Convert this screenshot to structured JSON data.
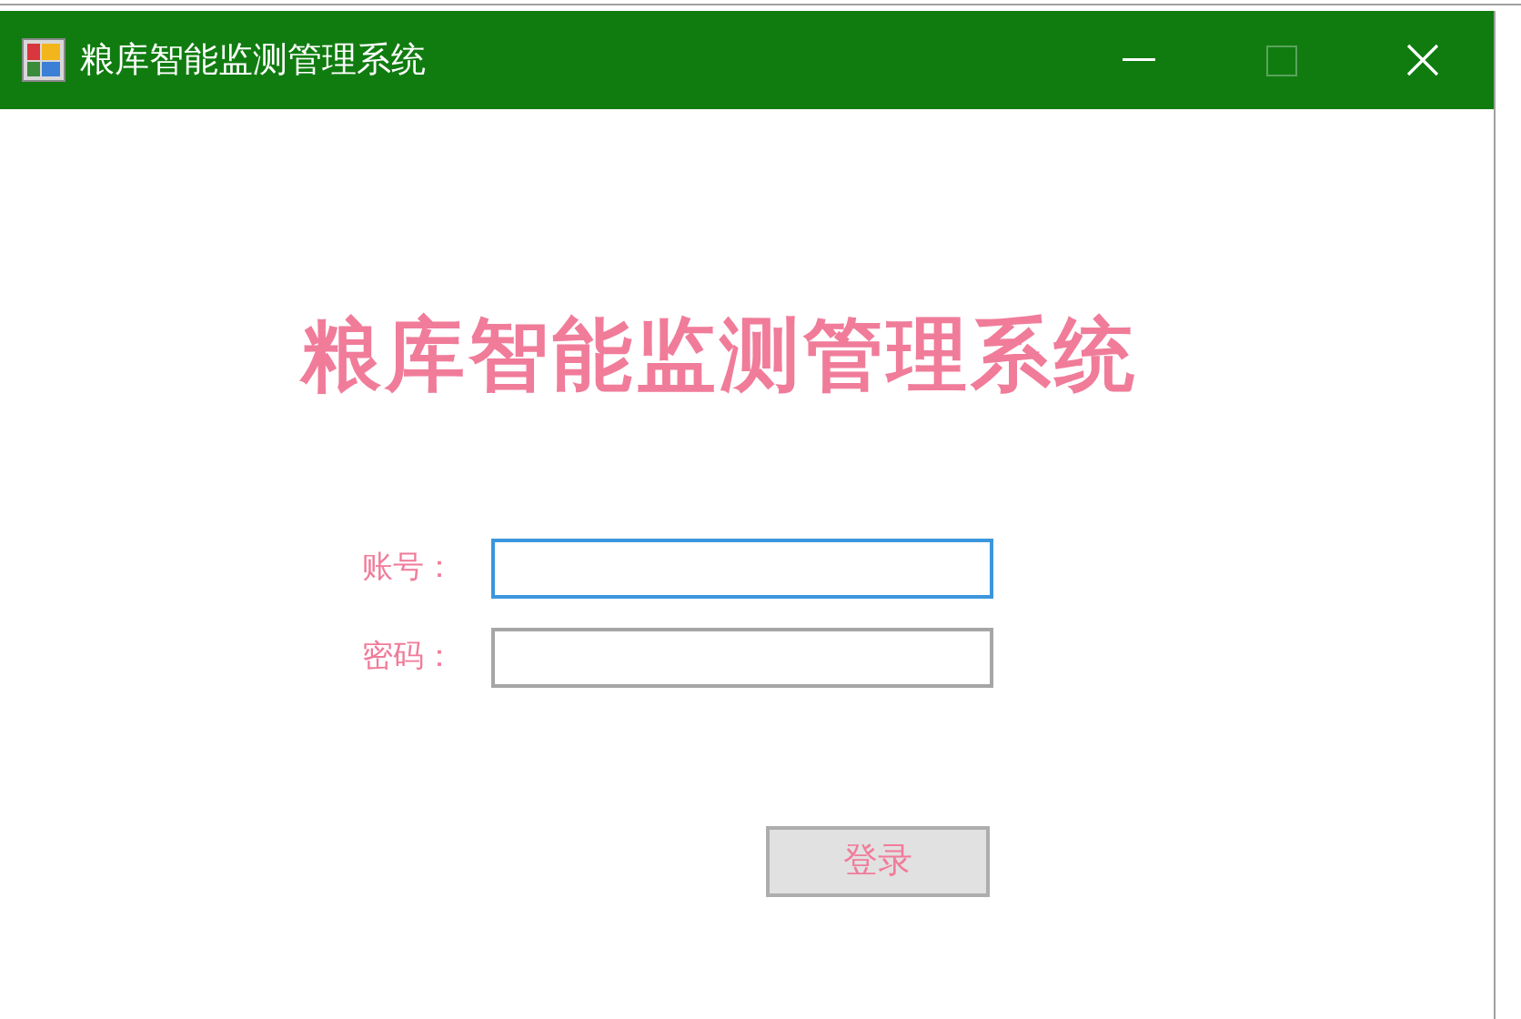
{
  "window": {
    "title": "粮库智能监测管理系统"
  },
  "heading": "粮库智能监测管理系统",
  "fields": [
    {
      "label": "账号：",
      "focused": true
    },
    {
      "label": "密码：",
      "focused": false
    }
  ],
  "login_button": "登录"
}
